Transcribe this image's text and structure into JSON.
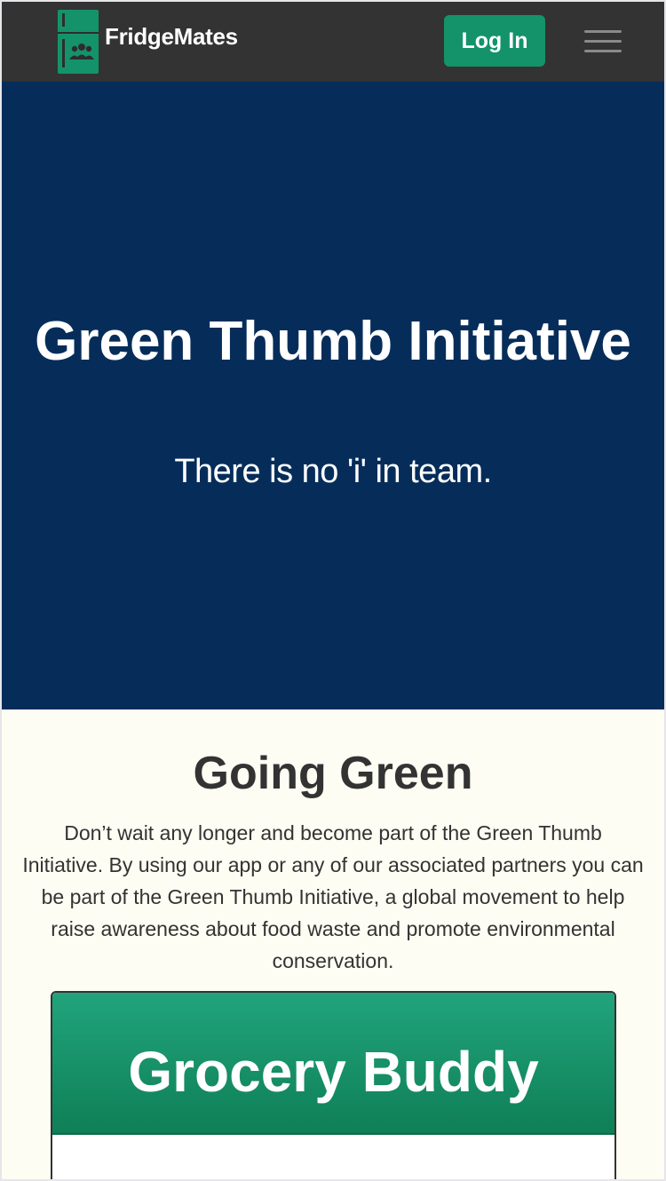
{
  "navbar": {
    "brand": "FridgeMates",
    "login_label": "Log In",
    "logo_icon": "fridge-people-icon",
    "menu_icon": "hamburger-icon",
    "background_color": "#333333",
    "accent_color": "#14936a"
  },
  "hero": {
    "title": "Green Thumb Initiative",
    "subtitle": "There is no 'i' in team.",
    "background_color": "#062d5a"
  },
  "section": {
    "heading": "Going Green",
    "body": "Don’t wait any longer and become part of the Green Thumb Initiative. By using our app or any of our associated partners you can be part of the Green Thumb Initiative, a global movement to help raise awareness about food waste and promote environmental conservation.",
    "background_color": "#fdfdf3"
  },
  "card": {
    "title": "Grocery Buddy"
  }
}
